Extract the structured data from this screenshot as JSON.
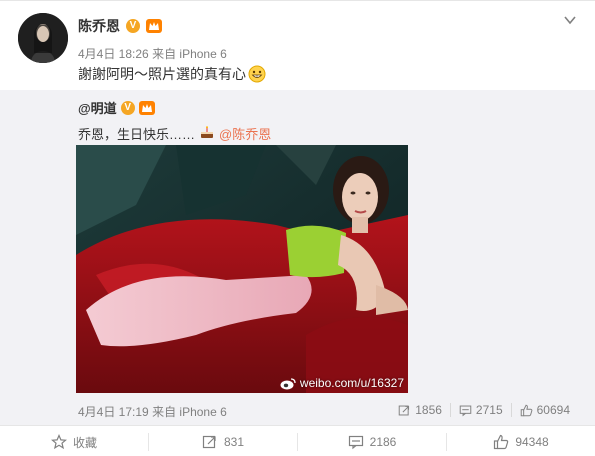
{
  "post": {
    "author": "陈乔恩",
    "time": "4月4日 18:26",
    "source": "来自 iPhone 6",
    "text": "謝謝阿明～照片選的真有心",
    "emoji": "grin-emoji"
  },
  "repost": {
    "author": "@明道",
    "text": "乔恩，生日快乐……",
    "mention": "@陈乔恩",
    "time": "4月4日 17:19",
    "source": "来自 iPhone 6",
    "reposts": "1856",
    "comments": "2715",
    "likes": "60694",
    "watermark": "weibo.com/u/16327"
  },
  "actions": {
    "favorite": "收藏",
    "reposts": "831",
    "comments": "2186",
    "likes": "94348"
  },
  "colors": {
    "accent": "#eb7350",
    "badge": "#f5a623",
    "member": "#ff8200",
    "repost_bg": "#f2f2f5"
  }
}
